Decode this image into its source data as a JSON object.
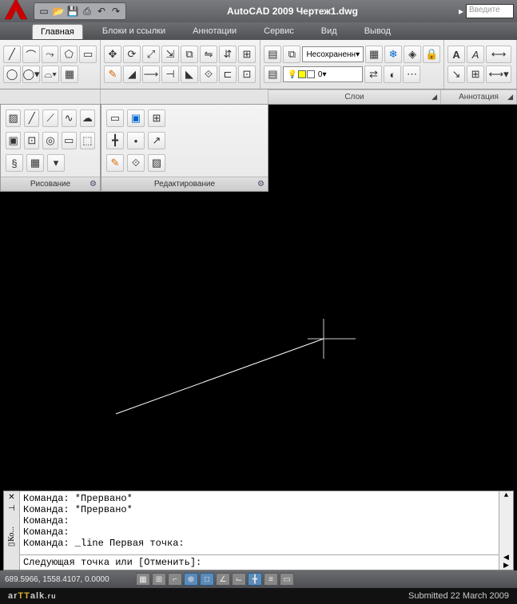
{
  "title": "AutoCAD 2009  Чертеж1.dwg",
  "search_placeholder": "Введите",
  "qat": [
    "new",
    "open",
    "save",
    "print",
    "undo",
    "redo"
  ],
  "menu": {
    "main": "Главная",
    "blocks": "Блоки и ссылки",
    "annot": "Аннотации",
    "service": "Сервис",
    "view": "Вид",
    "output": "Вывод"
  },
  "panels": {
    "layers": "Слои",
    "annotation": "Аннотация",
    "draw": "Рисование",
    "edit": "Редактирование"
  },
  "layer_combo": "Несохраненн",
  "layer_current": "0",
  "command": {
    "history": "Команда: *Прервано*\nКоманда: *Прервано*\nКоманда:\nКоманда:\nКоманда: _line Первая точка:",
    "prompt": "Следующая точка или [Отменить]:"
  },
  "status": {
    "coords": "689.5966, 1558.4107, 0.0000"
  },
  "footer": {
    "site_a": "ar",
    "site_b": "TT",
    "site_c": "alk",
    "tld": ".ru",
    "submitted": "Submitted 22 March 2009"
  },
  "chart_data": null
}
